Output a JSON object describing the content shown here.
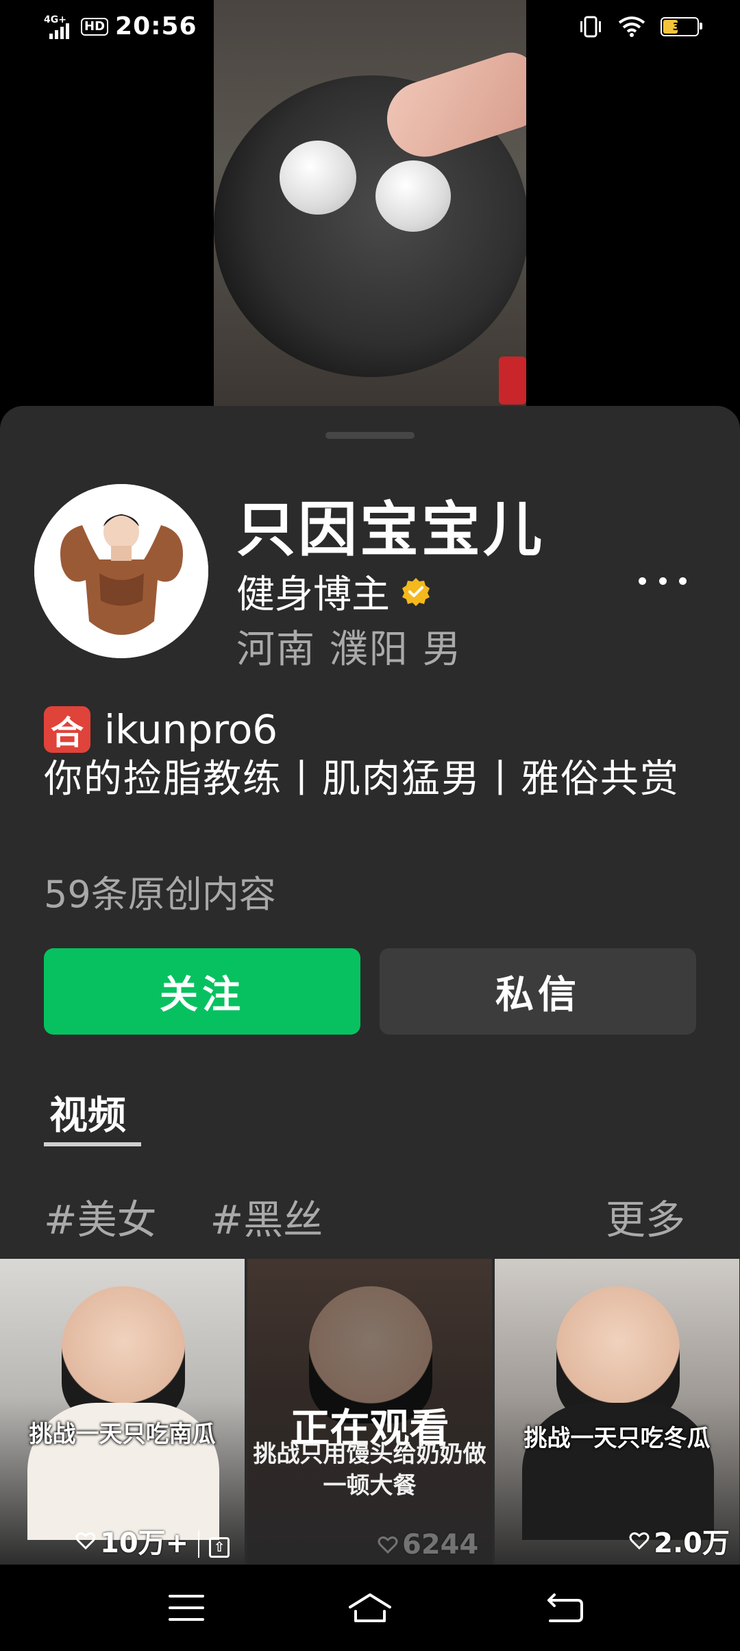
{
  "status_bar": {
    "network": "4G+",
    "hd": "HD",
    "time": "20:56",
    "battery": "32"
  },
  "profile": {
    "name": "只因宝宝儿",
    "role": "健身博主",
    "location": "河南 濮阳 男",
    "handle_badge": "合",
    "handle": "ikunpro6",
    "bio": "你的捡脂教练丨肌肉猛男丨雅俗共赏",
    "content_count": "59条原创内容"
  },
  "actions": {
    "follow": "关注",
    "message": "私信"
  },
  "tabs": {
    "video": "视频"
  },
  "tags": [
    "#美女",
    "#黑丝"
  ],
  "more": "更多",
  "videos": [
    {
      "caption": "挑战一天只吃南瓜",
      "likes": "10万+",
      "pinned": true
    },
    {
      "status": "正在观看",
      "caption": "挑战只用馒头给奶奶做一顿大餐",
      "likes": "6244"
    },
    {
      "caption": "挑战一天只吃冬瓜",
      "likes": "2.0万"
    }
  ],
  "colors": {
    "accent": "#07c160",
    "sheet": "#2b2b2b",
    "secondary_button": "#3c3c3c"
  }
}
